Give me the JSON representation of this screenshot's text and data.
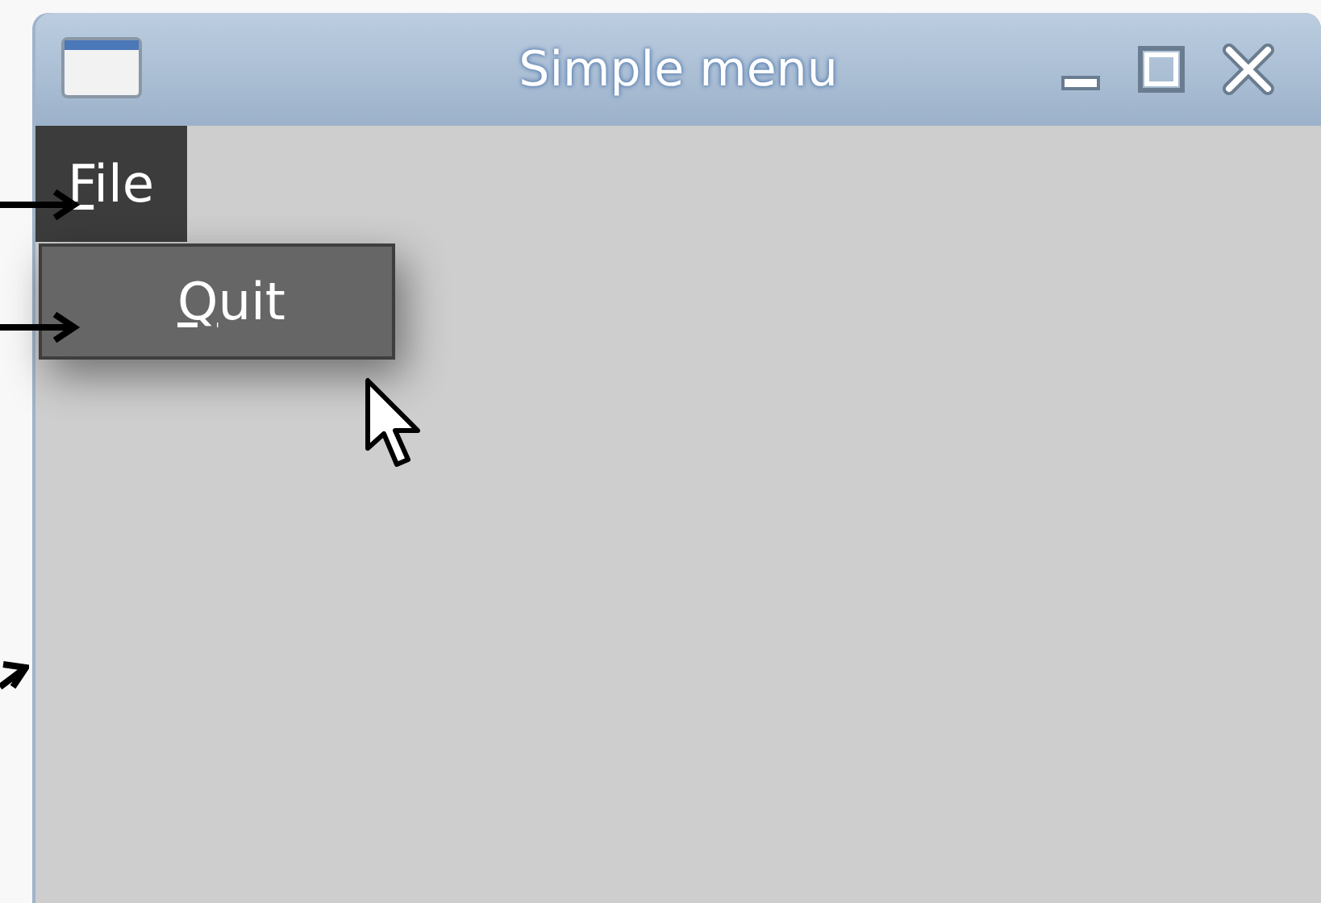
{
  "window": {
    "title": "Simple menu"
  },
  "menubar": [
    {
      "label": "File",
      "mnemonic_underlined": true,
      "expanded": true,
      "items": [
        {
          "label": "Quit",
          "mnemonic_underlined": true,
          "selected": true
        }
      ]
    }
  ]
}
